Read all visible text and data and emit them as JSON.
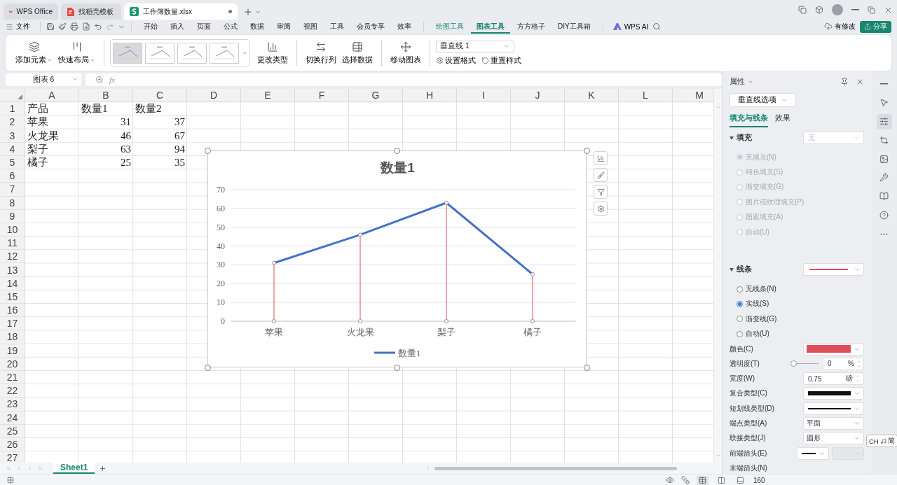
{
  "title_bar": {
    "tabs": [
      {
        "label": "WPS Office",
        "kind": "home",
        "selected": false
      },
      {
        "label": "找稻壳模板",
        "kind": "template",
        "selected": false
      },
      {
        "label": "工作簿数量.xlsx",
        "kind": "sheet",
        "selected": true
      }
    ]
  },
  "menu": {
    "file": "文件",
    "tabs": [
      {
        "label": "开始",
        "context": false,
        "selected": false
      },
      {
        "label": "插入",
        "context": false,
        "selected": false
      },
      {
        "label": "页面",
        "context": false,
        "selected": false
      },
      {
        "label": "公式",
        "context": false,
        "selected": false
      },
      {
        "label": "数据",
        "context": false,
        "selected": false
      },
      {
        "label": "审阅",
        "context": false,
        "selected": false
      },
      {
        "label": "视图",
        "context": false,
        "selected": false
      },
      {
        "label": "工具",
        "context": false,
        "selected": false
      },
      {
        "label": "会员专享",
        "context": false,
        "selected": false
      },
      {
        "label": "效率",
        "context": false,
        "selected": false
      },
      {
        "label": "绘图工具",
        "context": true,
        "selected": false
      },
      {
        "label": "图表工具",
        "context": true,
        "selected": true
      },
      {
        "label": "方方格子",
        "context": false,
        "selected": false
      },
      {
        "label": "DIY工具箱",
        "context": false,
        "selected": false
      }
    ],
    "ai": "WPS AI",
    "save_status": "有修改",
    "share": "分享"
  },
  "ribbon": {
    "layout_buttons": [
      "添加元素",
      "快速布局"
    ],
    "styles": [
      {
        "selected": true
      },
      {
        "selected": false
      },
      {
        "selected": false
      },
      {
        "selected": false
      }
    ],
    "change_type": "更改类型",
    "data_buttons": [
      "切换行列",
      "选择数据"
    ],
    "move": "移动图表",
    "element_select": "垂直线 1",
    "format_buttons": [
      "设置格式",
      "重置样式"
    ]
  },
  "formula_bar": {
    "name_box": "图表 6",
    "fx": "fx"
  },
  "sheet": {
    "columns": [
      "A",
      "B",
      "C",
      "D",
      "E",
      "F",
      "G",
      "H",
      "I",
      "J",
      "K",
      "L",
      "M"
    ],
    "rows": [
      "1",
      "2",
      "3",
      "4",
      "5",
      "6",
      "7",
      "8",
      "9",
      "10",
      "11",
      "12",
      "13",
      "14",
      "15",
      "16",
      "17",
      "18",
      "19",
      "20",
      "21",
      "22",
      "23",
      "24",
      "25",
      "26",
      "27"
    ],
    "cells": [
      [
        {
          "text": "产品",
          "kind": "text"
        },
        {
          "text": "数量1",
          "kind": "text"
        },
        {
          "text": "数量2",
          "kind": "text"
        }
      ],
      [
        {
          "text": "苹果",
          "kind": "text"
        },
        {
          "text": "31",
          "kind": "number"
        },
        {
          "text": "37",
          "kind": "number"
        }
      ],
      [
        {
          "text": "火龙果",
          "kind": "text"
        },
        {
          "text": "46",
          "kind": "number"
        },
        {
          "text": "67",
          "kind": "number"
        }
      ],
      [
        {
          "text": "梨子",
          "kind": "text"
        },
        {
          "text": "63",
          "kind": "number"
        },
        {
          "text": "94",
          "kind": "number"
        }
      ],
      [
        {
          "text": "橘子",
          "kind": "text"
        },
        {
          "text": "25",
          "kind": "number"
        },
        {
          "text": "35",
          "kind": "number"
        }
      ]
    ]
  },
  "chart": {
    "chart_data": {
      "type": "line",
      "title": "数量1",
      "categories": [
        "苹果",
        "火龙果",
        "梨子",
        "橘子"
      ],
      "series": [
        {
          "name": "数量1",
          "color": "#4472c4",
          "marker": "circle",
          "values": [
            31,
            46,
            63,
            25
          ]
        }
      ],
      "ylim": [
        0,
        70
      ],
      "yticks": [
        0,
        10,
        20,
        30,
        40,
        50,
        60,
        70
      ],
      "grid": true
    }
  },
  "properties": {
    "title": "属性",
    "options_select": "垂直线选项",
    "tabs": [
      {
        "label": "填充与线条",
        "selected": true
      },
      {
        "label": "效果",
        "selected": false
      }
    ],
    "fill": {
      "title": "填充",
      "select": "无",
      "disabled": true,
      "options": [
        {
          "label": "无填充(N)",
          "selected": true
        },
        {
          "label": "纯色填充(S)",
          "selected": false
        },
        {
          "label": "渐变填充(G)",
          "selected": false
        },
        {
          "label": "图片或纹理填充(P)",
          "selected": false
        },
        {
          "label": "图案填充(A)",
          "selected": false
        },
        {
          "label": "自动(U)",
          "selected": false
        }
      ]
    },
    "line": {
      "title": "线条",
      "options": [
        {
          "label": "无线条(N)",
          "selected": false
        },
        {
          "label": "实线(S)",
          "selected": true
        },
        {
          "label": "渐变线(G)",
          "selected": false
        },
        {
          "label": "自动(U)",
          "selected": false
        }
      ],
      "fields": [
        {
          "kind": "color",
          "label": "颜色(C)",
          "color": "#e24d5c"
        },
        {
          "kind": "slider",
          "label": "透明度(T)",
          "level": 0,
          "value": "0",
          "unit": "%"
        },
        {
          "kind": "spin",
          "label": "宽度(W)",
          "value": "0.75",
          "unit": "磅"
        },
        {
          "kind": "compound",
          "label": "复合类型(C)"
        },
        {
          "kind": "dash",
          "label": "短划线类型(D)"
        },
        {
          "kind": "select",
          "label": "端点类型(A)",
          "value": "平面"
        },
        {
          "kind": "select",
          "label": "联接类型(J)",
          "value": "圆形"
        },
        {
          "kind": "arrow",
          "label": "前端箭头(E)"
        },
        {
          "kind": "plain",
          "label": "末端箭头(N)"
        }
      ]
    }
  },
  "sheet_tabs": [
    {
      "label": "Sheet1",
      "selected": true
    }
  ],
  "status_bar": {
    "zoom": "160"
  },
  "ime": {
    "language": "CH",
    "mode": "简"
  }
}
